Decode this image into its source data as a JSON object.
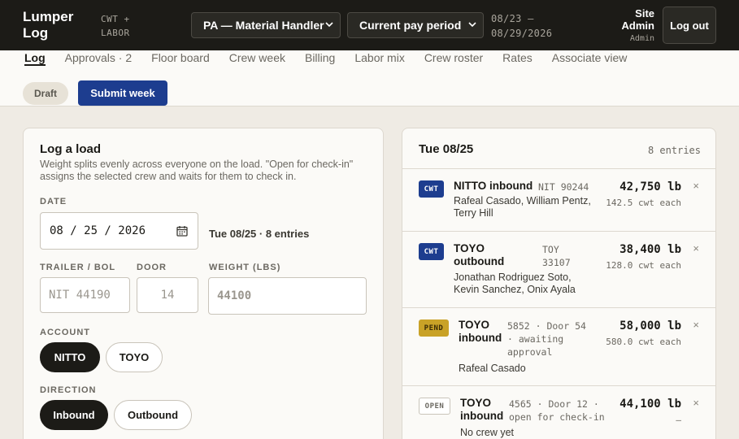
{
  "app": {
    "brand": "Lumper Log",
    "brand_sub": "CWT + LABOR"
  },
  "header": {
    "site_select": "PA — Material Handler",
    "period_select": "Current pay period",
    "dates_line1": "08/23 –",
    "dates_line2": "08/29/2026",
    "user_name": "Site Admin",
    "user_role": "Admin",
    "logout_label": "Log out"
  },
  "nav": {
    "tabs": [
      "Log",
      "Approvals · 2",
      "Floor board",
      "Crew week",
      "Billing",
      "Labor mix",
      "Crew roster",
      "Rates",
      "Associate view"
    ],
    "status_badge": "Draft",
    "submit_label": "Submit week"
  },
  "log_form": {
    "title": "Log a load",
    "description": "Weight splits evenly across everyone on the load. \"Open for check-in\" assigns the selected crew and waits for them to check in.",
    "date_label": "DATE",
    "date_value": "08 / 25 / 2026",
    "date_summary": "Tue 08/25 · 8 entries",
    "trailer_label": "TRAILER / BOL",
    "trailer_placeholder": "NIT 44190",
    "door_label": "DOOR",
    "door_placeholder": "14",
    "weight_label": "WEIGHT (LBS)",
    "weight_placeholder": "44100",
    "account_label": "ACCOUNT",
    "accounts": [
      "NITTO",
      "TOYO"
    ],
    "direction_label": "DIRECTION",
    "directions": [
      "Inbound",
      "Outbound"
    ]
  },
  "day_panel": {
    "title": "Tue 08/25",
    "count": "8 entries",
    "entries": [
      {
        "tag": "CWT",
        "name": "NITTO inbound",
        "ref": "NIT 90244",
        "crew": "Rafeal Casado, William Pentz, Terry Hill",
        "weight": "42,750 lb",
        "each": "142.5 cwt each"
      },
      {
        "tag": "CWT",
        "name": "TOYO outbound",
        "ref": "TOY 33107",
        "crew": "Jonathan Rodriguez Soto, Kevin Sanchez, Onix Ayala",
        "weight": "38,400 lb",
        "each": "128.0 cwt each"
      },
      {
        "tag": "PEND",
        "name": "TOYO inbound",
        "ref": "5852 · Door 54 · awaiting approval",
        "crew": "Rafeal Casado",
        "weight": "58,000 lb",
        "each": "580.0 cwt each"
      },
      {
        "tag": "OPEN",
        "name": "TOYO inbound",
        "ref": "4565 · Door 12 · open for check-in",
        "crew": "No crew yet",
        "weight": "44,100 lb",
        "each": "–"
      }
    ],
    "remove_glyph": "×"
  }
}
